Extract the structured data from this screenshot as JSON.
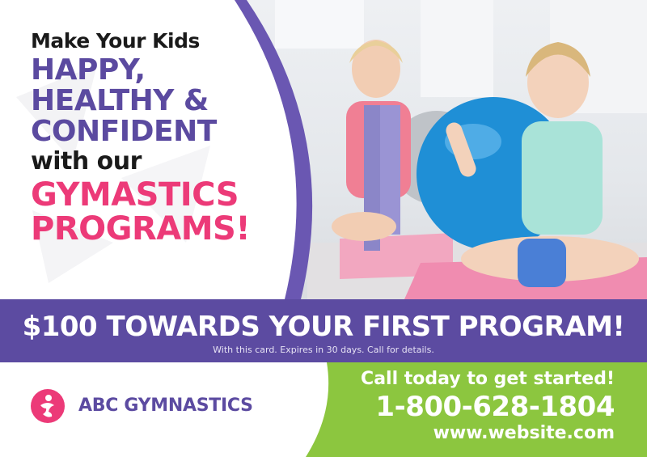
{
  "headline": {
    "line1": "Make Your Kids",
    "line2": "HAPPY,",
    "line3": "HEALTHY &",
    "line4": "CONFIDENT",
    "line5": "with our",
    "line6": "GYMASTICS",
    "line7": "PROGRAMS!"
  },
  "offer": {
    "title": "$100 TOWARDS YOUR FIRST PROGRAM!",
    "subtitle": "With this card. Expires in 30 days. Call for details."
  },
  "brand": {
    "name": "ABC GYMNASTICS",
    "logo_icon": "gymnast-logo-icon"
  },
  "contact": {
    "call_text": "Call today to get started!",
    "phone": "1-800-628-1804",
    "website": "www.website.com"
  },
  "colors": {
    "purple": "#5c4ba1",
    "pink": "#ec3a78",
    "green": "#8cc63f",
    "dark": "#1a1a1a"
  }
}
